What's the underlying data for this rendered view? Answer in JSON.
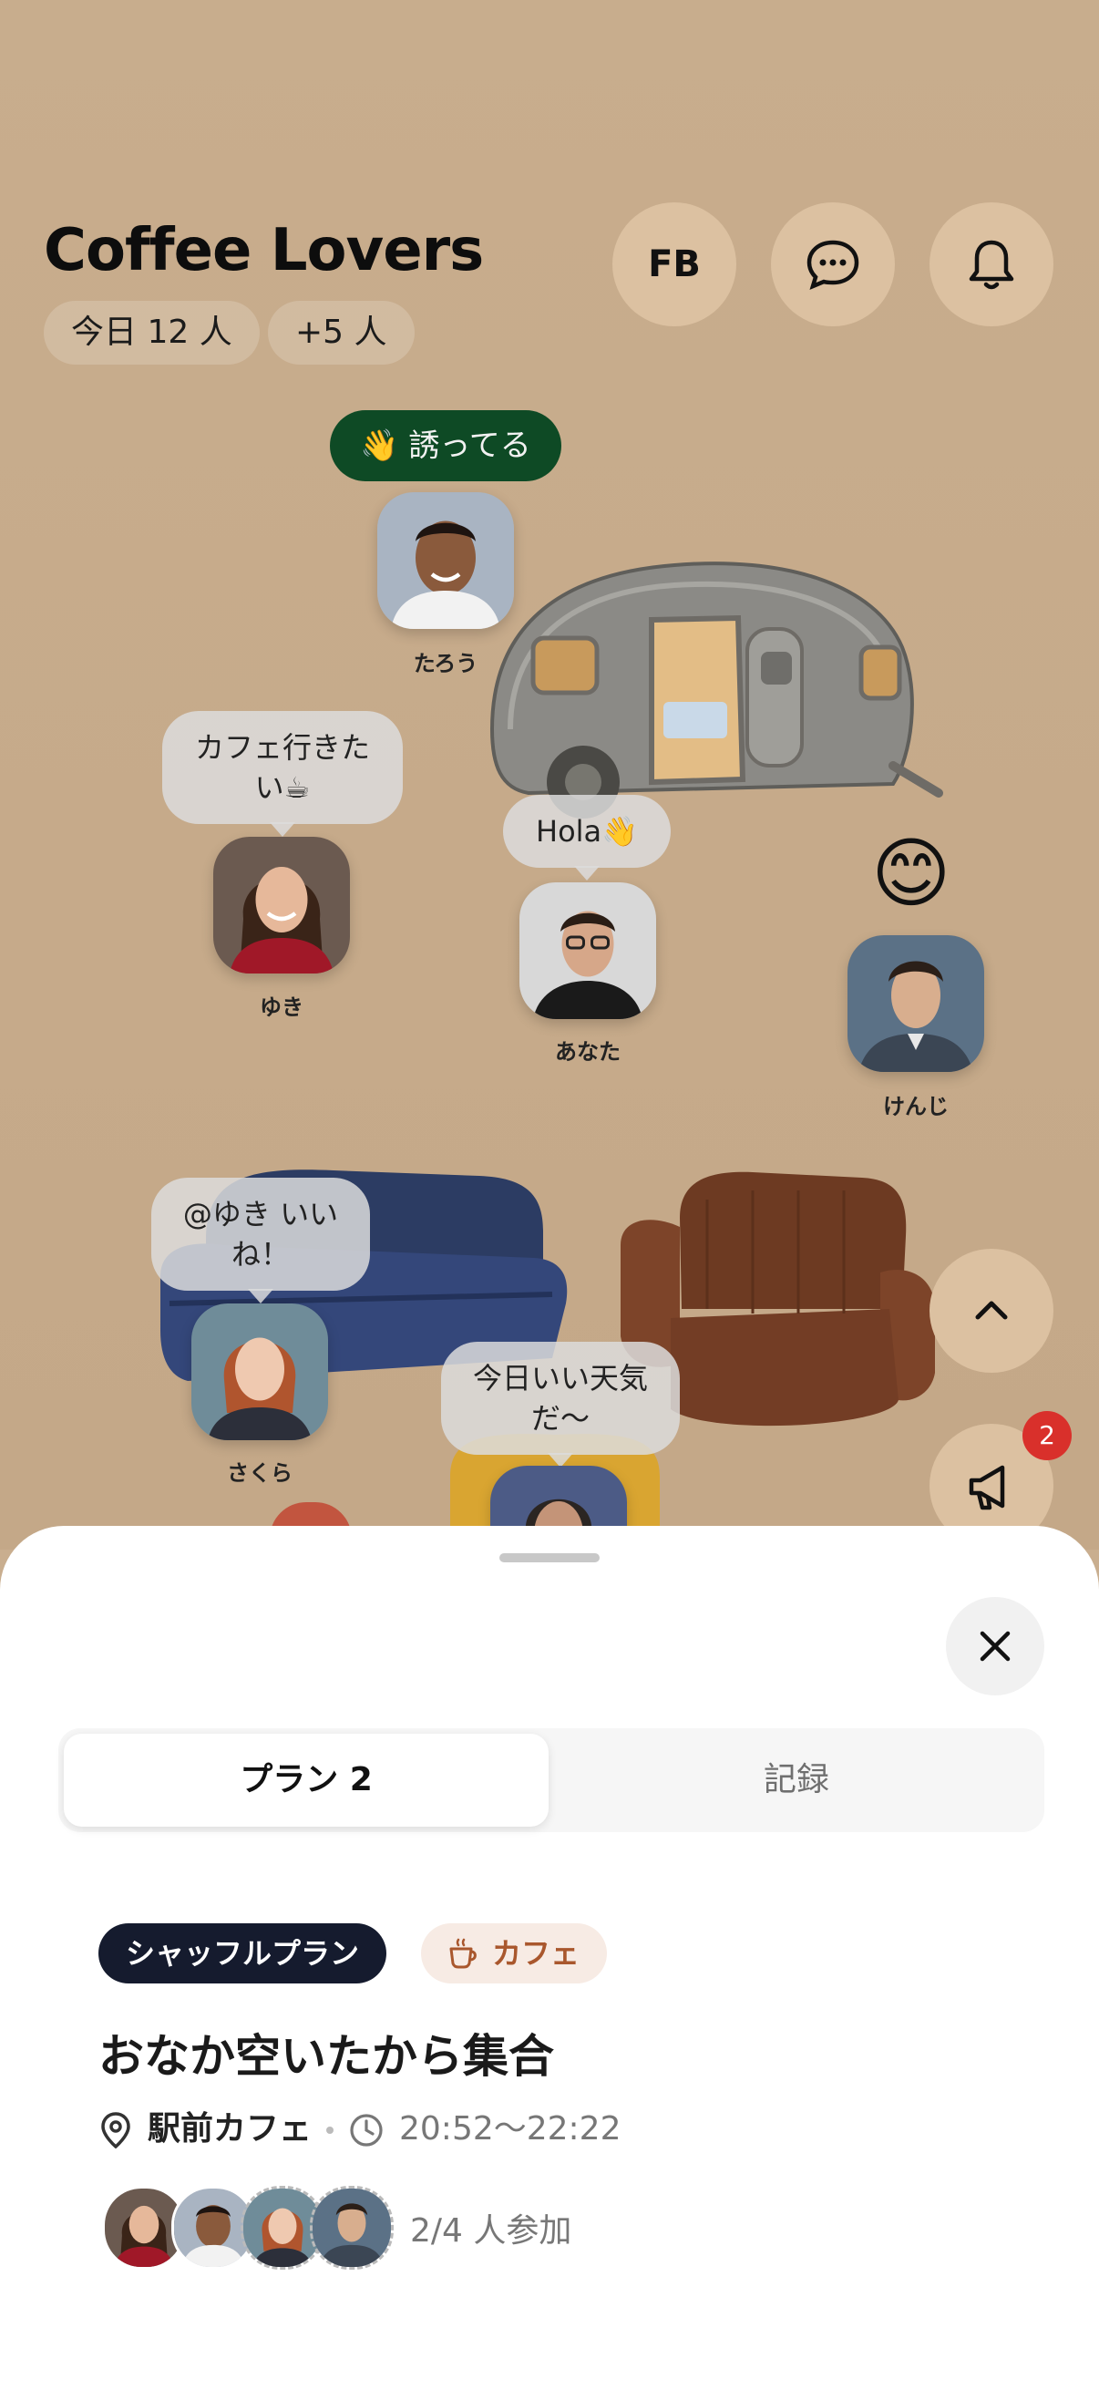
{
  "header": {
    "title": "Coffee Lovers",
    "today_count": "今日 12 人",
    "extra_count": "+5 人",
    "fb_label": "FB"
  },
  "status_chip": {
    "emoji": "👋",
    "label": "誘ってる"
  },
  "people": [
    {
      "name": "たろう"
    },
    {
      "name": "ゆき",
      "message": "カフェ行きたい☕"
    },
    {
      "name": "あなた",
      "message": "Hola👋"
    },
    {
      "name": "けんじ",
      "reaction": "😊"
    },
    {
      "name": "さくら",
      "message": "@ゆき いいね！"
    },
    {
      "message": "今日いい天気だ〜"
    }
  ],
  "floating": {
    "notification_count": "2"
  },
  "sheet": {
    "tabs": [
      {
        "label": "プラン 2",
        "active": true
      },
      {
        "label": "記録",
        "active": false
      }
    ],
    "plan": {
      "type_badge": "シャッフルプラン",
      "category": "カフェ",
      "title": "おなか空いたから集合",
      "location": "駅前カフェ",
      "time": "20:52〜22:22",
      "participants": "2/4 人参加"
    }
  },
  "colors": {
    "accent_green": "#0e4a25",
    "dark_badge": "#151b2e",
    "cafe_text": "#a9572d",
    "notif_red": "#d9302b"
  }
}
